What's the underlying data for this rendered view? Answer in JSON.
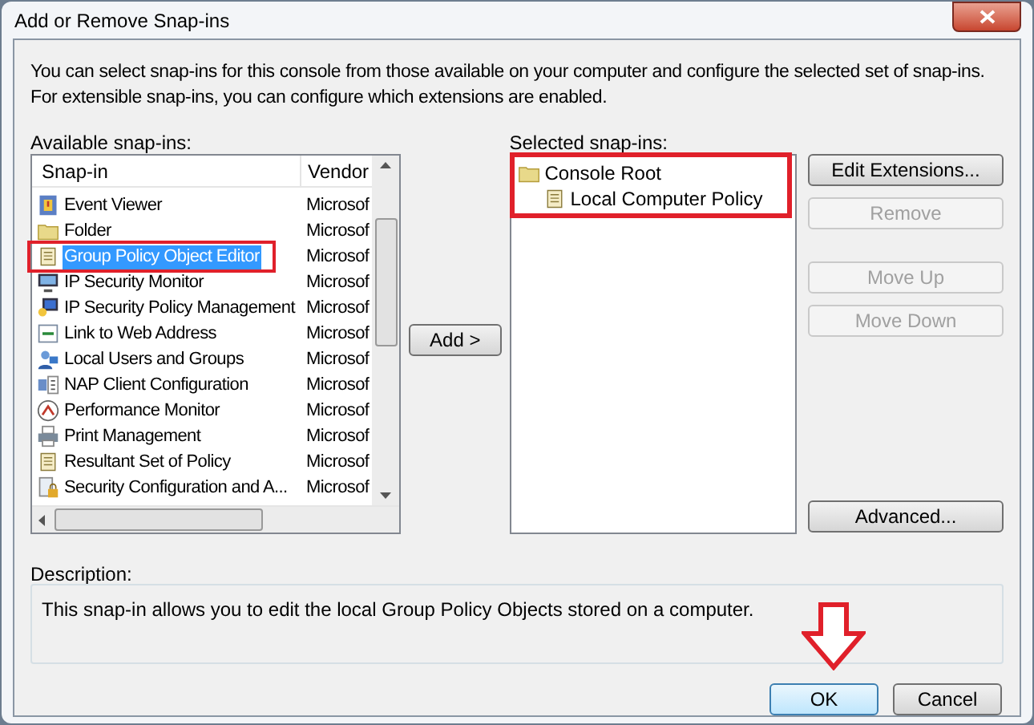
{
  "window": {
    "title": "Add or Remove Snap-ins"
  },
  "intro": "You can select snap-ins for this console from those available on your computer and configure the selected set of snap-ins. For extensible snap-ins, you can configure which extensions are enabled.",
  "available": {
    "label": "Available snap-ins:",
    "columns": [
      "Snap-in",
      "Vendor"
    ],
    "rows": [
      {
        "name": "Event Viewer",
        "vendor": "Microsof",
        "kind": "event",
        "selected": false,
        "highlighted": false
      },
      {
        "name": "Folder",
        "vendor": "Microsof",
        "kind": "folder",
        "selected": false,
        "highlighted": false
      },
      {
        "name": "Group Policy Object Editor",
        "vendor": "Microsof",
        "kind": "scroll",
        "selected": true,
        "highlighted": true
      },
      {
        "name": "IP Security Monitor",
        "vendor": "Microsof",
        "kind": "monitor",
        "selected": false,
        "highlighted": false
      },
      {
        "name": "IP Security Policy Management",
        "vendor": "Microsof",
        "kind": "shield",
        "selected": false,
        "highlighted": false
      },
      {
        "name": "Link to Web Address",
        "vendor": "Microsof",
        "kind": "link",
        "selected": false,
        "highlighted": false
      },
      {
        "name": "Local Users and Groups",
        "vendor": "Microsof",
        "kind": "users",
        "selected": false,
        "highlighted": false
      },
      {
        "name": "NAP Client Configuration",
        "vendor": "Microsof",
        "kind": "nap",
        "selected": false,
        "highlighted": false
      },
      {
        "name": "Performance Monitor",
        "vendor": "Microsof",
        "kind": "gauge",
        "selected": false,
        "highlighted": false
      },
      {
        "name": "Print Management",
        "vendor": "Microsof",
        "kind": "printer",
        "selected": false,
        "highlighted": false
      },
      {
        "name": "Resultant Set of Policy",
        "vendor": "Microsof",
        "kind": "scroll",
        "selected": false,
        "highlighted": false
      },
      {
        "name": "Security Configuration and A...",
        "vendor": "Microsof",
        "kind": "lock",
        "selected": false,
        "highlighted": false
      }
    ]
  },
  "add_button": "Add >",
  "selected_panel": {
    "label": "Selected snap-ins:",
    "highlighted": true,
    "tree": [
      {
        "label": "Console Root",
        "kind": "folder",
        "children": [
          {
            "label": "Local Computer Policy",
            "kind": "scroll"
          }
        ]
      }
    ]
  },
  "side_buttons": [
    {
      "label": "Edit Extensions...",
      "disabled": false
    },
    {
      "label": "Remove",
      "disabled": true
    },
    {
      "label": "Move Up",
      "disabled": true
    },
    {
      "label": "Move Down",
      "disabled": true
    }
  ],
  "advanced_button": {
    "label": "Advanced...",
    "disabled": false
  },
  "description": {
    "label": "Description:",
    "text": "This snap-in allows you to edit the local Group Policy Objects stored on a computer."
  },
  "footer_buttons": [
    {
      "label": "OK",
      "default": true
    },
    {
      "label": "Cancel",
      "default": false
    }
  ]
}
